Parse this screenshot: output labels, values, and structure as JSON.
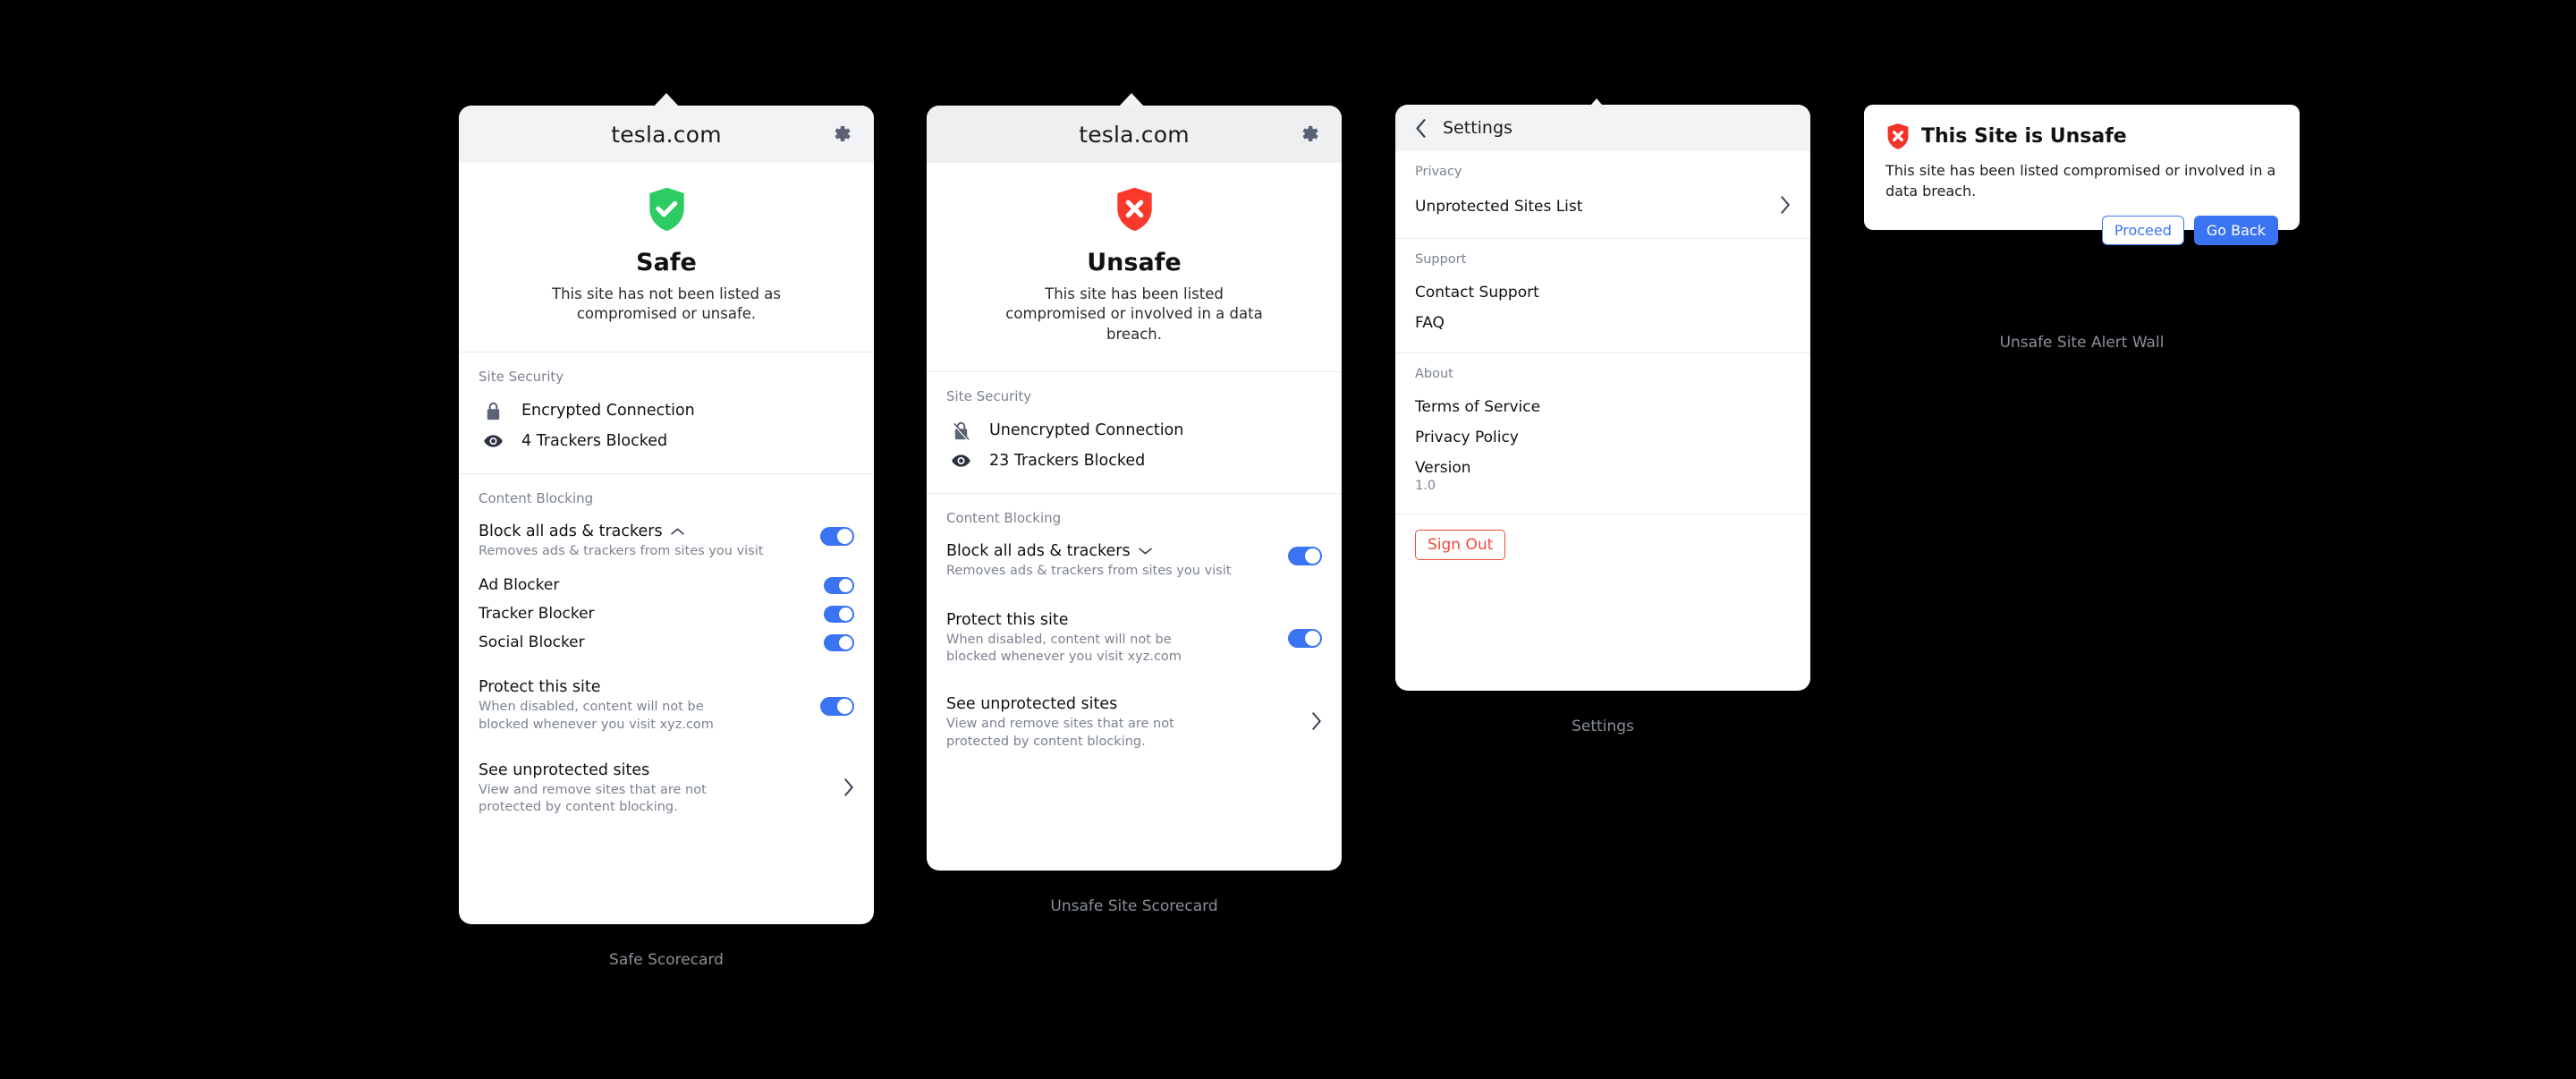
{
  "colors": {
    "background": "#000000",
    "card": "#ffffff",
    "header_bg": "#F2F3F5",
    "safe_green": "#2DCC62",
    "unsafe_red": "#F9392B",
    "toggle_blue": "#3B74F2",
    "signout_red": "#F04A3A",
    "muted_text": "#7B8290",
    "caption_text": "#8A9099"
  },
  "safe_scorecard": {
    "caption": "Safe Scorecard",
    "header": {
      "domain": "tesla.com",
      "gear_icon": "gear-icon"
    },
    "hero": {
      "status_icon": "shield-check-icon",
      "title": "Safe",
      "subtitle": "This site has not been listed as compromised or unsafe."
    },
    "site_security": {
      "label": "Site Security",
      "rows": [
        {
          "icon": "lock-icon",
          "text": "Encrypted Connection"
        },
        {
          "icon": "eye-icon",
          "text": "4 Trackers Blocked"
        }
      ]
    },
    "content_blocking": {
      "label": "Content Blocking",
      "block_all": {
        "title": "Block all ads & trackers",
        "chevron": "chevron-up-icon",
        "description": "Removes ads & trackers from sites you visit",
        "toggle_on": true
      },
      "sub_toggles": [
        {
          "label": "Ad Blocker",
          "toggle_on": true
        },
        {
          "label": "Tracker Blocker",
          "toggle_on": true
        },
        {
          "label": "Social Blocker",
          "toggle_on": true
        }
      ],
      "protect": {
        "title": "Protect this site",
        "description": "When disabled, content will not be blocked whenever you visit xyz.com",
        "toggle_on": true
      },
      "see_unprotected": {
        "title": "See unprotected sites",
        "description": "View and remove sites that are not protected by content blocking.",
        "chevron": "chevron-right-icon"
      }
    }
  },
  "unsafe_scorecard": {
    "caption": "Unsafe Site Scorecard",
    "header": {
      "domain": "tesla.com",
      "gear_icon": "gear-icon"
    },
    "hero": {
      "status_icon": "shield-x-icon",
      "title": "Unsafe",
      "subtitle": "This site has been listed compromised or involved in a data breach."
    },
    "site_security": {
      "label": "Site Security",
      "rows": [
        {
          "icon": "lock-open-slash-icon",
          "text": "Unencrypted Connection"
        },
        {
          "icon": "eye-icon",
          "text": "23 Trackers Blocked"
        }
      ]
    },
    "content_blocking": {
      "label": "Content Blocking",
      "block_all": {
        "title": "Block all ads & trackers",
        "chevron": "chevron-down-icon",
        "description": "Removes ads & trackers from sites you visit",
        "toggle_on": true
      },
      "protect": {
        "title": "Protect this site",
        "description": "When disabled, content will not be blocked whenever you visit xyz.com",
        "toggle_on": true
      },
      "see_unprotected": {
        "title": "See unprotected sites",
        "description": "View and remove sites that are not protected by content blocking.",
        "chevron": "chevron-right-icon"
      }
    }
  },
  "settings": {
    "caption": "Settings",
    "header": {
      "back_icon": "chevron-left-icon",
      "title": "Settings"
    },
    "groups": [
      {
        "label": "Privacy",
        "items": [
          {
            "label": "Unprotected Sites List",
            "chevron": "chevron-right-icon"
          }
        ]
      },
      {
        "label": "Support",
        "items": [
          {
            "label": "Contact Support"
          },
          {
            "label": "FAQ"
          }
        ]
      },
      {
        "label": "About",
        "items": [
          {
            "label": "Terms of Service"
          },
          {
            "label": "Privacy Policy"
          },
          {
            "label": "Version",
            "sub": "1.0"
          }
        ]
      }
    ],
    "sign_out_label": "Sign Out"
  },
  "alert": {
    "caption": "Unsafe Site Alert Wall",
    "icon": "shield-x-icon",
    "title": "This Site is Unsafe",
    "body": "This site has been listed compromised or involved in a data breach.",
    "buttons": {
      "secondary": "Proceed",
      "primary": "Go Back"
    }
  }
}
